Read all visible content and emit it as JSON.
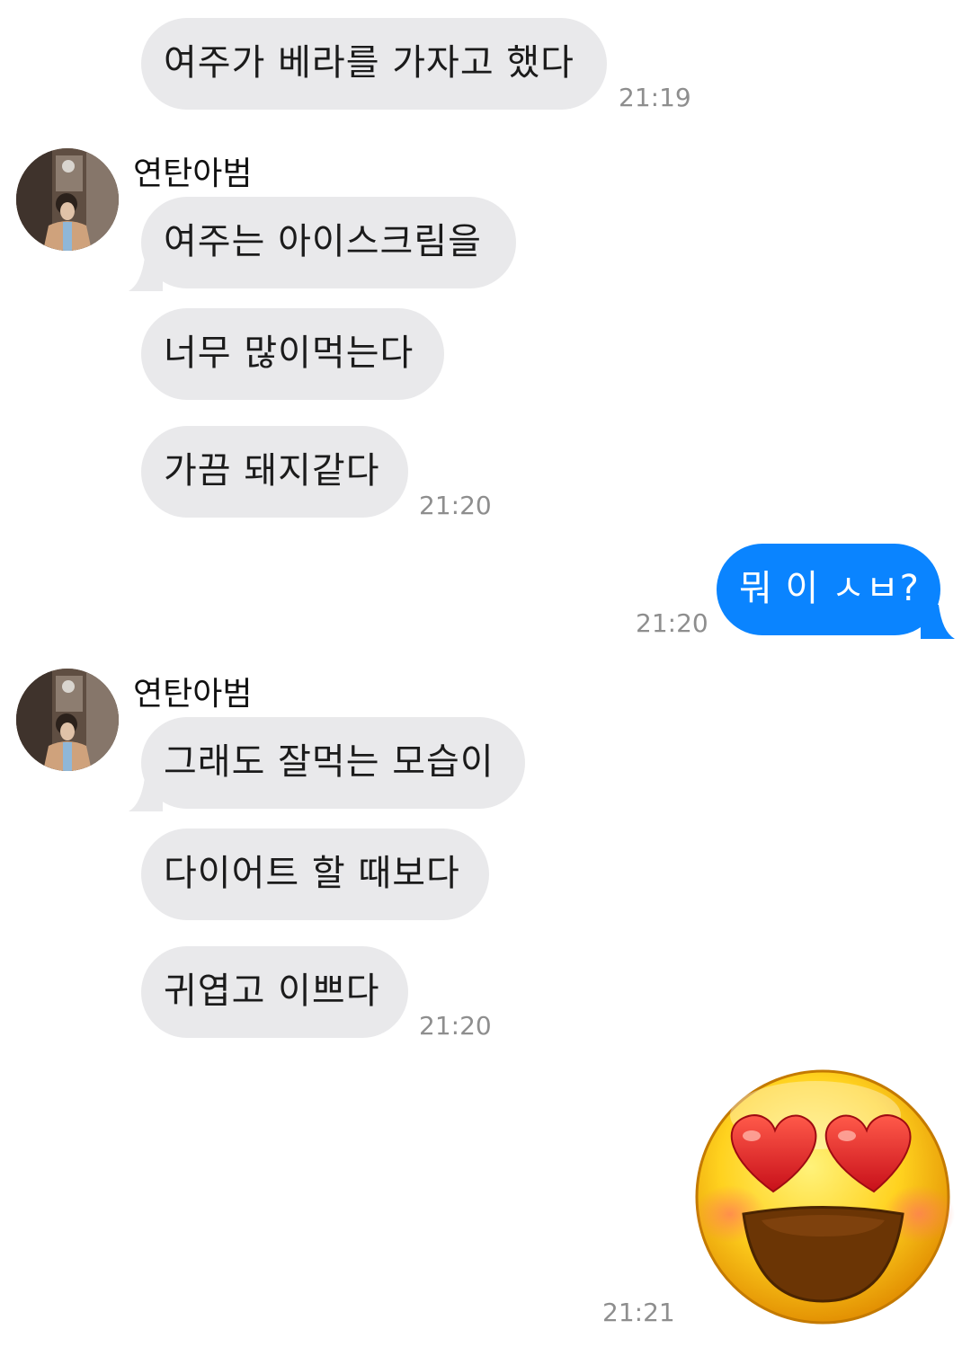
{
  "messages": {
    "m1": {
      "text": "여주가 베라를 가자고 했다",
      "time": "21:19"
    },
    "group1": {
      "sender": "연탄아범",
      "m2": "여주는 아이스크림을",
      "m3": "너무 많이먹는다",
      "m4": "가끔 돼지같다",
      "time": "21:20"
    },
    "sent1": {
      "text": "뭐 이 ㅅㅂ?",
      "time": "21:20"
    },
    "group2": {
      "sender": "연탄아범",
      "m5": "그래도 잘먹는 모습이",
      "m6": "다이어트 할 때보다",
      "m7": "귀엽고 이쁘다",
      "time": "21:20"
    },
    "sent2": {
      "emoji": "smiling-face-with-heart-eyes",
      "time": "21:21"
    }
  },
  "colors": {
    "received_bubble": "#e9e9eb",
    "sent_bubble": "#0a84ff",
    "timestamp": "#8e8e8e"
  }
}
